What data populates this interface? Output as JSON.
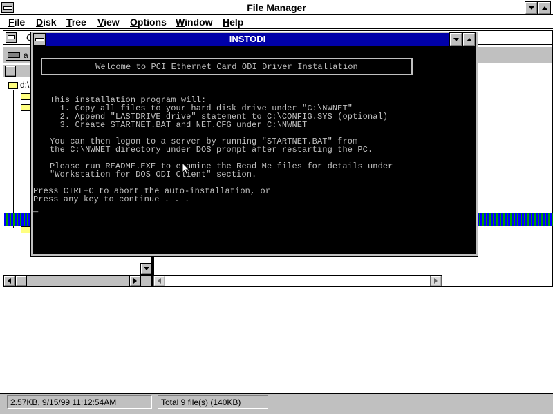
{
  "app": {
    "title": "File Manager"
  },
  "menu": {
    "items": [
      {
        "label": "File",
        "hotkey": "F",
        "rest": "ile"
      },
      {
        "label": "Disk",
        "hotkey": "D",
        "rest": "isk"
      },
      {
        "label": "Tree",
        "hotkey": "T",
        "rest": "ree"
      },
      {
        "label": "View",
        "hotkey": "V",
        "rest": "iew"
      },
      {
        "label": "Options",
        "hotkey": "O",
        "rest": "ptions"
      },
      {
        "label": "Window",
        "hotkey": "W",
        "rest": "indow"
      },
      {
        "label": "Help",
        "hotkey": "H",
        "rest": "elp"
      }
    ]
  },
  "drivebar": {
    "drive_letter": "a",
    "drive_label_partial": "C"
  },
  "tree": {
    "root_label": "d:\\"
  },
  "dos_window": {
    "title": "INSTODI",
    "banner": "Welcome to PCI Ethernet Card ODI Driver Installation",
    "lines": [
      "This installation program will:",
      "  1. Copy all files to your hard disk drive under \"C:\\NWNET\"",
      "  2. Append \"LASTDRIVE=drive\" statement to C:\\CONFIG.SYS (optional)",
      "  3. Create STARTNET.BAT and NET.CFG under C:\\NWNET",
      "",
      "You can then logon to a server by running \"STARTNET.BAT\" from",
      "the C:\\NWNET directory under DOS prompt after restarting the PC.",
      "",
      "Please run README.EXE to examine the Read Me files for details under",
      "\"Workstation for DOS ODI Client\" section."
    ],
    "prompt_lines": [
      "Press CTRL+C to abort the auto-installation, or",
      "Press any key to continue . . ."
    ],
    "cursor": "_"
  },
  "status": {
    "left": "2.57KB, 9/15/99 11:12:54AM",
    "right": "Total 9 file(s) (140KB)"
  },
  "colors": {
    "title_active": "#0000a8",
    "dos_bg": "#000000",
    "dos_text": "#c0c0c0",
    "folder": "#ffff80",
    "progress_blue": "#0000ff",
    "progress_green": "#00a000"
  }
}
